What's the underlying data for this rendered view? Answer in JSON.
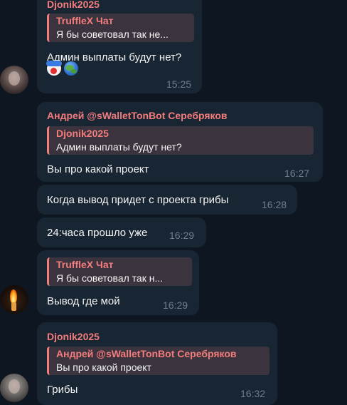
{
  "messages": [
    {
      "sender": "Djonik2025",
      "reply": {
        "name": "TruffleX Чат",
        "text": "Я бы советовал так не..."
      },
      "text": "Админ выплаты будут нет?",
      "emojis": [
        "clown-emoji",
        "earth-emoji"
      ],
      "time": "15:25"
    },
    {
      "sender": "Андрей @sWalletTonBot Серебряков",
      "reply": {
        "name": "Djonik2025",
        "text": "Админ выплаты будут нет?"
      },
      "text": "Вы про какой проект",
      "time": "16:27"
    },
    {
      "text": "Когда вывод придет с проекта грибы",
      "time": "16:28"
    },
    {
      "text": "24:часа прошло уже",
      "time": "16:29"
    },
    {
      "reply": {
        "name": "TruffleX Чат",
        "text": "Я бы советовал так н..."
      },
      "text": "Вывод где мой",
      "time": "16:29"
    },
    {
      "sender": "Djonik2025",
      "reply": {
        "name": "Андрей @sWalletTonBot Серебряков",
        "text": "Вы про какой проект"
      },
      "text": "Грибы",
      "time": "16:32"
    }
  ],
  "colors": {
    "background": "#0e1621",
    "bubble": "#182533",
    "accent": "#f37c7c",
    "time": "#6d7f8f"
  }
}
